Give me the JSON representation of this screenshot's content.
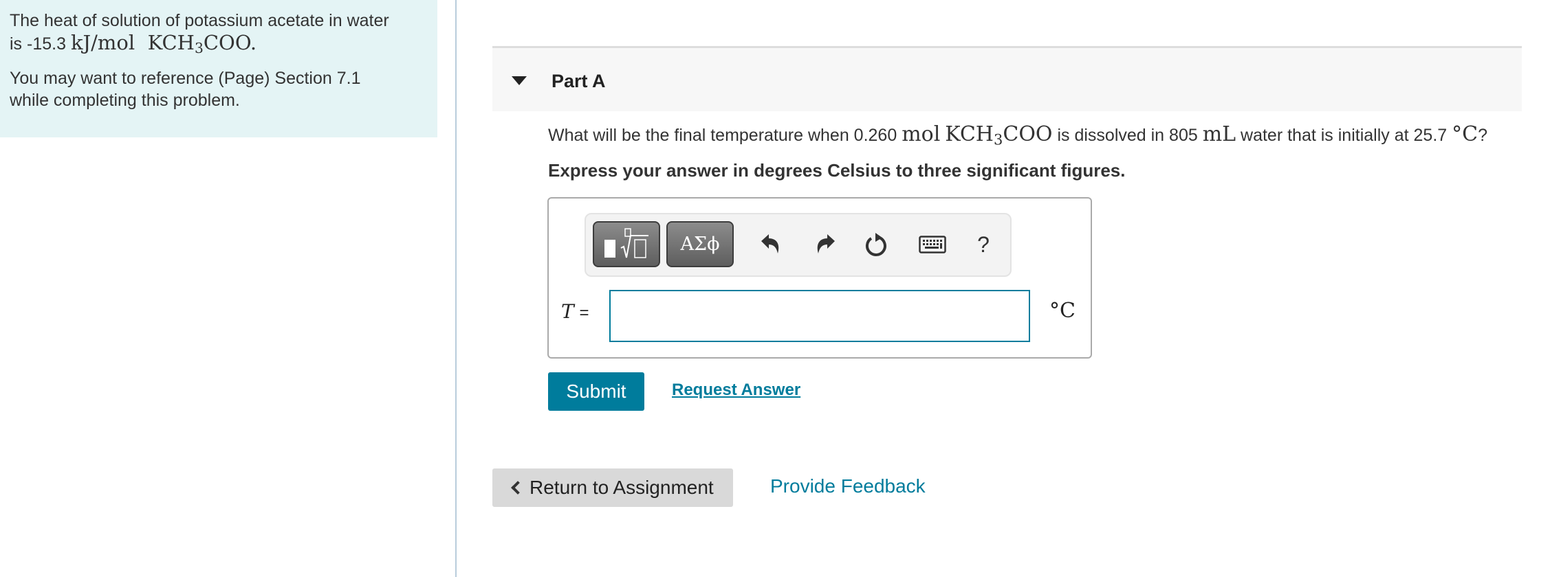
{
  "intro": {
    "line1": "The heat of solution of potassium acetate in water",
    "line2_prefix": "is -15.3 ",
    "line2_unit": "kJ/mol",
    "line2_formula_a": "KCH",
    "line2_formula_sub": "3",
    "line2_formula_b": "COO",
    "line2_suffix": ".",
    "reference_line1": "You may want to reference (Page) Section 7.1",
    "reference_line2": "while completing this problem."
  },
  "part": {
    "title": "Part A",
    "question": {
      "prefix": "What will be the final temperature when 0.260 ",
      "mol": "mol",
      "formula_a": "KCH",
      "formula_sub": "3",
      "formula_b": "COO",
      "middle": " is dissolved in 805 ",
      "ml": "mL",
      "suffix_text": " water that is initially at 25.7 ",
      "temp_unit": "°C",
      "end": "?"
    },
    "instruction": "Express your answer in degrees Celsius to three significant figures."
  },
  "toolbar": {
    "symbols_label": "ΑΣϕ",
    "help_label": "?",
    "icons": [
      "templates-icon",
      "greek-symbols-icon",
      "undo-icon",
      "redo-icon",
      "reset-icon",
      "keyboard-icon",
      "help-icon"
    ]
  },
  "answer": {
    "variable": "T",
    "equals": "=",
    "value": "",
    "unit": "°C"
  },
  "actions": {
    "submit_label": "Submit",
    "request_answer_label": "Request Answer",
    "return_label": "Return to Assignment",
    "feedback_label": "Provide Feedback"
  },
  "colors": {
    "accent": "#007c9c",
    "intro_bg": "#e4f4f5",
    "header_bg": "#f7f7f7"
  }
}
